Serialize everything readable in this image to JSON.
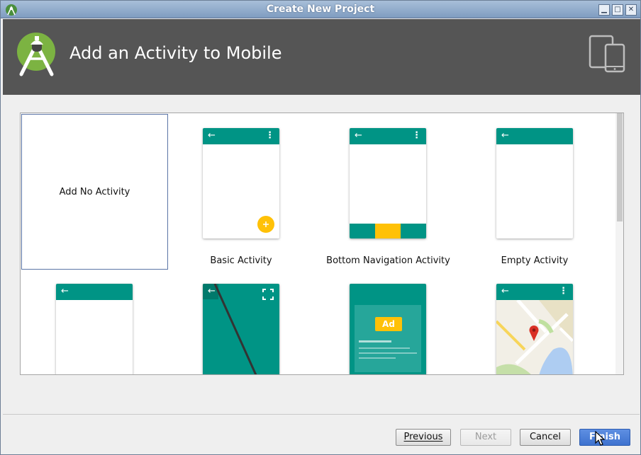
{
  "window": {
    "title": "Create New Project",
    "minimize": "▁",
    "maximize": "□",
    "close": "✕"
  },
  "header": {
    "title": "Add an Activity to Mobile",
    "logo_icon": "android-studio-logo",
    "device_icon": "phone-tablet-icon",
    "background": "#555555"
  },
  "gallery": {
    "tiles": [
      {
        "label": "Add No Activity",
        "selected": true
      },
      {
        "label": "Basic Activity"
      },
      {
        "label": "Bottom Navigation Activity"
      },
      {
        "label": "Empty Activity"
      },
      {
        "label": ""
      },
      {
        "label": ""
      },
      {
        "label": ""
      },
      {
        "label": ""
      }
    ],
    "ad_badge": "Ad",
    "accent_teal": "#009485",
    "accent_yellow": "#FFC107"
  },
  "buttons": {
    "previous": "Previous",
    "next": "Next",
    "cancel": "Cancel",
    "finish": "Finish"
  }
}
